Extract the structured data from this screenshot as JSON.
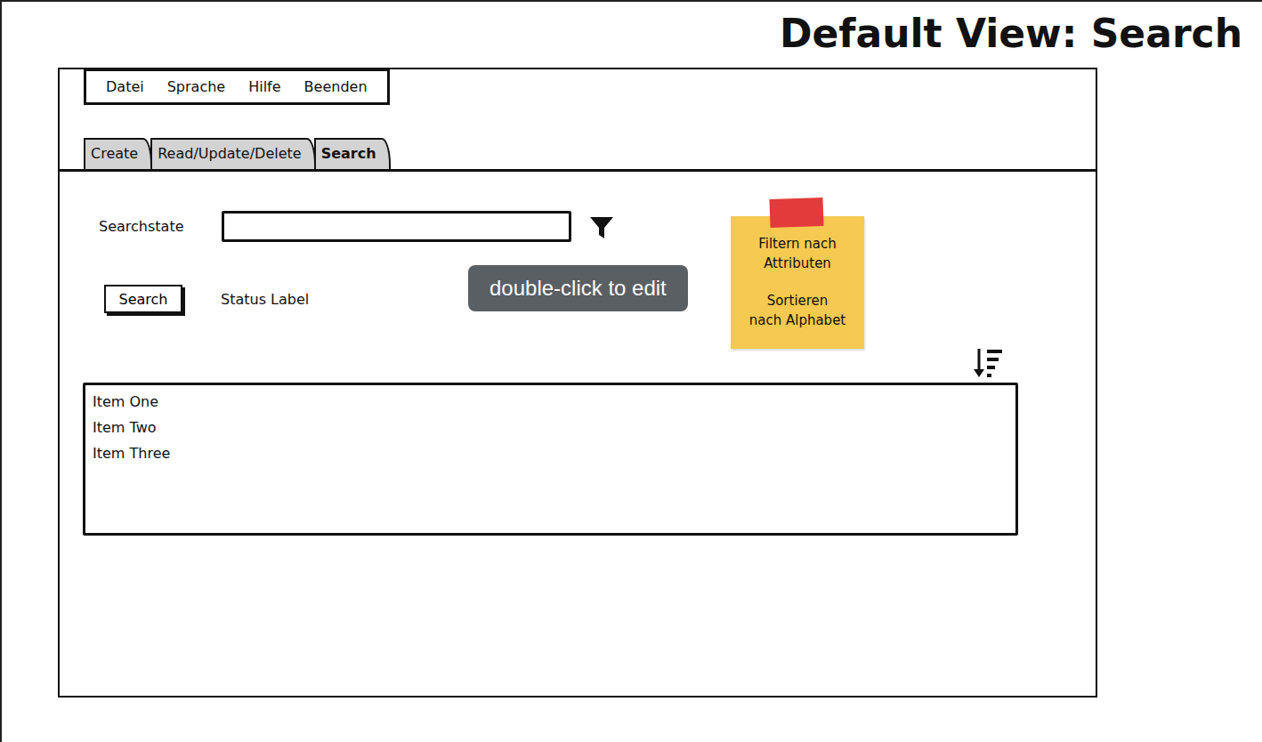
{
  "title": "Default View: Search",
  "menu": [
    "Datei",
    "Sprache",
    "Hilfe",
    "Beenden"
  ],
  "tabs": [
    {
      "label": "Create",
      "selected": false
    },
    {
      "label": "Read/Update/Delete",
      "selected": false
    },
    {
      "label": "Search",
      "selected": true
    }
  ],
  "search": {
    "label": "Searchstate",
    "value": ""
  },
  "button": "Search",
  "status": "Status Label",
  "tooltip": "double-click to edit",
  "sticky_note": {
    "paragraphs": [
      [
        "Filtern nach",
        "Attributen"
      ],
      [
        "Sortieren",
        "nach Alphabet"
      ]
    ]
  },
  "list": {
    "items": [
      "Item One",
      "Item Two",
      "Item Three"
    ]
  }
}
